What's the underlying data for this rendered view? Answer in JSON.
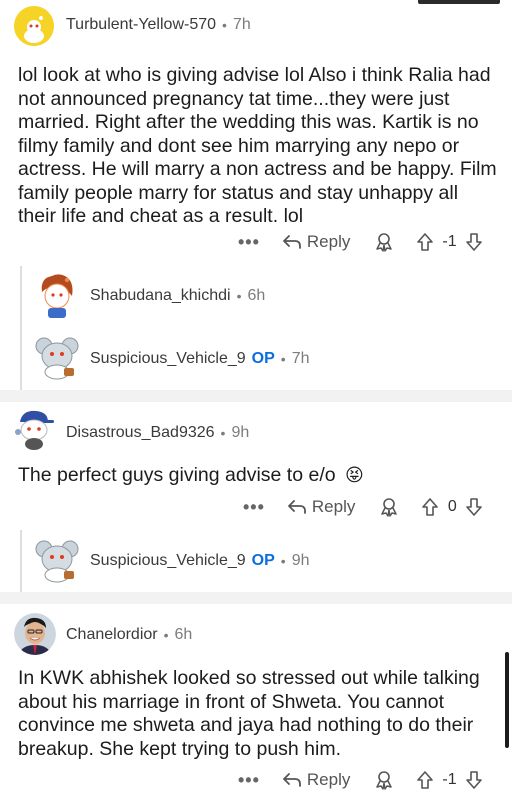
{
  "comments": [
    {
      "username": "Turbulent-Yellow-570",
      "time": "7h",
      "body": "lol look at who is giving advise lol  Also i think Ralia had not announced pregnancy tat time...they were just married. Right after the wedding this was. Kartik is no filmy family and dont see him marrying any nepo or actress. He will marry a non actress and be happy. Film family people marry for status and stay unhappy all their life and cheat as a result. lol",
      "reply_label": "Reply",
      "score": "-1",
      "more": "•••"
    },
    {
      "username": "Shabudana_khichdi",
      "time": "6h"
    },
    {
      "username": "Suspicious_Vehicle_9",
      "op": "OP",
      "time": "7h"
    },
    {
      "username": "Disastrous_Bad9326",
      "time": "9h",
      "body": "The perfect guys giving advise to e/o",
      "emoji": "😝",
      "reply_label": "Reply",
      "score": "0",
      "more": "•••"
    },
    {
      "username": "Suspicious_Vehicle_9",
      "op": "OP",
      "time": "9h"
    },
    {
      "username": "Chanelordior",
      "time": "6h",
      "body": "In KWK abhishek looked so stressed out while talking about his marriage in front of Shweta. You cannot convince me shweta and jaya had nothing to do their breakup. She kept trying to push him.",
      "reply_label": "Reply",
      "score": "-1",
      "more": "•••"
    }
  ],
  "separator": "•",
  "colors": {
    "op": "#0a6ee0",
    "meta": "#7c7c7c",
    "thread": "#dedede",
    "section_bg": "#f2f2f2"
  }
}
